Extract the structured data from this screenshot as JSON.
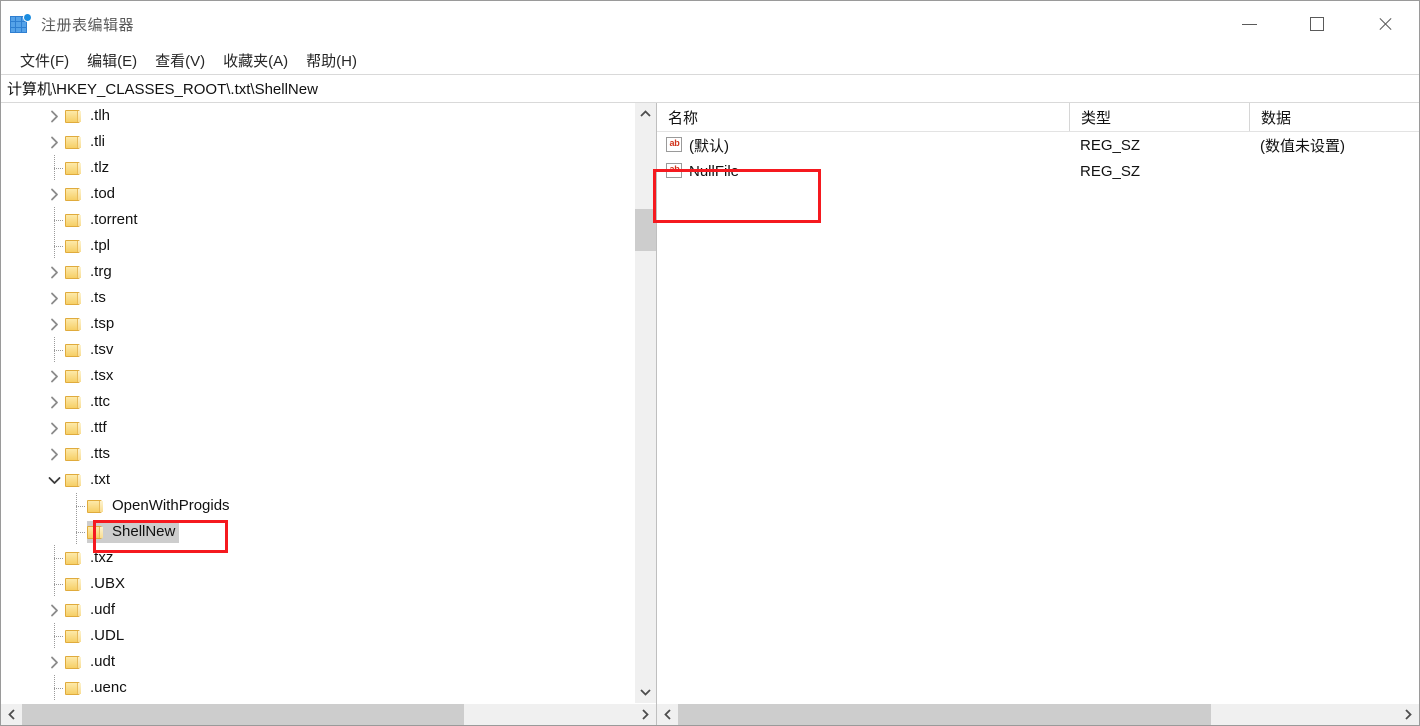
{
  "window": {
    "title": "注册表编辑器",
    "icon": "registry-editor-icon",
    "controls": {
      "minimize": "—",
      "maximize": "▢",
      "close": "✕"
    }
  },
  "menubar": {
    "items": [
      {
        "label": "文件(F)",
        "name": "menu-file"
      },
      {
        "label": "编辑(E)",
        "name": "menu-edit"
      },
      {
        "label": "查看(V)",
        "name": "menu-view"
      },
      {
        "label": "收藏夹(A)",
        "name": "menu-favorites"
      },
      {
        "label": "帮助(H)",
        "name": "menu-help"
      }
    ]
  },
  "address": {
    "path": "计算机\\HKEY_CLASSES_ROOT\\.txt\\ShellNew"
  },
  "tree": {
    "nodes": [
      {
        "label": ".tlh",
        "indent": 0,
        "expander": "collapsed",
        "selected": false
      },
      {
        "label": ".tli",
        "indent": 0,
        "expander": "collapsed",
        "selected": false
      },
      {
        "label": ".tlz",
        "indent": 0,
        "expander": "leaf",
        "selected": false
      },
      {
        "label": ".tod",
        "indent": 0,
        "expander": "collapsed",
        "selected": false
      },
      {
        "label": ".torrent",
        "indent": 0,
        "expander": "leaf",
        "selected": false
      },
      {
        "label": ".tpl",
        "indent": 0,
        "expander": "leaf",
        "selected": false
      },
      {
        "label": ".trg",
        "indent": 0,
        "expander": "collapsed",
        "selected": false
      },
      {
        "label": ".ts",
        "indent": 0,
        "expander": "collapsed",
        "selected": false
      },
      {
        "label": ".tsp",
        "indent": 0,
        "expander": "collapsed",
        "selected": false
      },
      {
        "label": ".tsv",
        "indent": 0,
        "expander": "leaf",
        "selected": false
      },
      {
        "label": ".tsx",
        "indent": 0,
        "expander": "collapsed",
        "selected": false
      },
      {
        "label": ".ttc",
        "indent": 0,
        "expander": "collapsed",
        "selected": false
      },
      {
        "label": ".ttf",
        "indent": 0,
        "expander": "collapsed",
        "selected": false
      },
      {
        "label": ".tts",
        "indent": 0,
        "expander": "collapsed",
        "selected": false
      },
      {
        "label": ".txt",
        "indent": 0,
        "expander": "expanded",
        "selected": false
      },
      {
        "label": "OpenWithProgids",
        "indent": 1,
        "expander": "leaf",
        "selected": false
      },
      {
        "label": "ShellNew",
        "indent": 1,
        "expander": "leaf",
        "selected": true
      },
      {
        "label": ".txz",
        "indent": 0,
        "expander": "leaf",
        "selected": false
      },
      {
        "label": ".UBX",
        "indent": 0,
        "expander": "leaf",
        "selected": false
      },
      {
        "label": ".udf",
        "indent": 0,
        "expander": "collapsed",
        "selected": false
      },
      {
        "label": ".UDL",
        "indent": 0,
        "expander": "leaf",
        "selected": false
      },
      {
        "label": ".udt",
        "indent": 0,
        "expander": "collapsed",
        "selected": false
      },
      {
        "label": ".uenc",
        "indent": 0,
        "expander": "leaf",
        "selected": false
      }
    ]
  },
  "values": {
    "columns": [
      {
        "label": "名称",
        "name": "column-name"
      },
      {
        "label": "类型",
        "name": "column-type"
      },
      {
        "label": "数据",
        "name": "column-data"
      }
    ],
    "rows": [
      {
        "icon": "string-value-icon",
        "name": "(默认)",
        "type": "REG_SZ",
        "data": "(数值未设置)"
      },
      {
        "icon": "string-value-icon",
        "name": "NullFile",
        "type": "REG_SZ",
        "data": ""
      }
    ]
  },
  "annotations": {
    "color": "#f5191f",
    "boxes": [
      {
        "name": "annotation-nullfile-row",
        "target": "NullFile"
      },
      {
        "name": "annotation-shellnew-node",
        "target": "ShellNew"
      }
    ]
  },
  "scrollbars": {
    "left_vertical": {
      "up_glyph": "⌃",
      "down_glyph": "⌄"
    },
    "left_horizontal": {
      "left_glyph": "‹",
      "right_glyph": "›"
    },
    "right_horizontal": {
      "left_glyph": "‹",
      "right_glyph": "›"
    }
  }
}
